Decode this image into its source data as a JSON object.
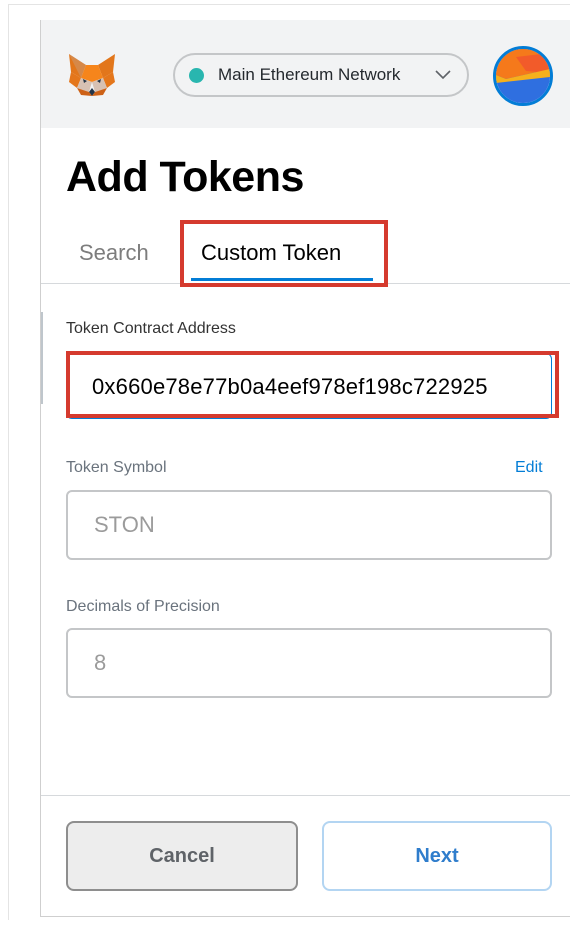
{
  "header": {
    "network_label": "Main Ethereum Network",
    "network_status_color": "#29b6af"
  },
  "page": {
    "title": "Add Tokens"
  },
  "tabs": [
    {
      "label": "Search",
      "active": false
    },
    {
      "label": "Custom Token",
      "active": true
    }
  ],
  "form": {
    "address": {
      "label": "Token Contract Address",
      "value": "0x660e78e77b0a4eef978ef198c722925"
    },
    "symbol": {
      "label": "Token Symbol",
      "edit_label": "Edit",
      "value": "STON"
    },
    "decimals": {
      "label": "Decimals of Precision",
      "value": "8"
    }
  },
  "footer": {
    "cancel_label": "Cancel",
    "next_label": "Next"
  },
  "colors": {
    "accent": "#037dd6",
    "highlight_box": "#d53a2e",
    "header_bg": "#f2f3f4"
  },
  "icons": {
    "logo": "metamask-fox-icon",
    "network_dropdown": "chevron-down-icon",
    "account": "account-avatar"
  }
}
